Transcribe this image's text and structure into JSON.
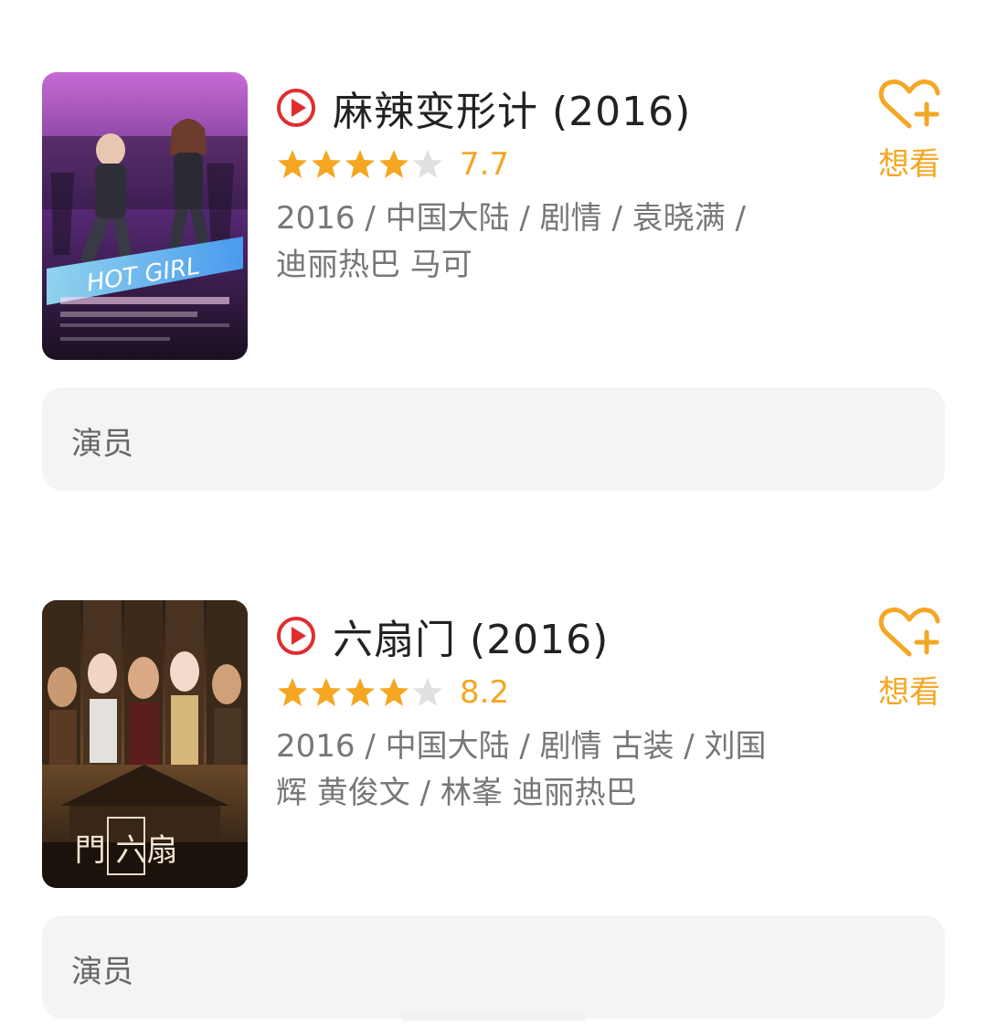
{
  "movies": [
    {
      "title": "麻辣变形计 (2016)",
      "rating": 7.7,
      "rating_display": "7.7",
      "stars_filled": 4,
      "stars_total": 5,
      "meta": "2016 / 中国大陆 / 剧情 / 袁晓满 / 迪丽热巴 马可",
      "want_label": "想看",
      "actors_label": "演员",
      "poster_text": "HOT GIRL"
    },
    {
      "title": "六扇门 (2016)",
      "rating": 8.2,
      "rating_display": "8.2",
      "stars_filled": 4,
      "stars_total": 5,
      "meta": "2016 / 中国大陆 / 剧情 古装 / 刘国辉 黄俊文 / 林峯 迪丽热巴",
      "want_label": "想看",
      "actors_label": "演员",
      "poster_text": "門 六扇"
    }
  ],
  "colors": {
    "accent": "#f5a623",
    "play": "#e02e2e",
    "star_empty": "#e0e0e0",
    "title": "#222222",
    "meta": "#777777",
    "panel": "#f4f4f4"
  },
  "icons": [
    "play-circle-icon",
    "star-icon",
    "heart-plus-icon"
  ]
}
